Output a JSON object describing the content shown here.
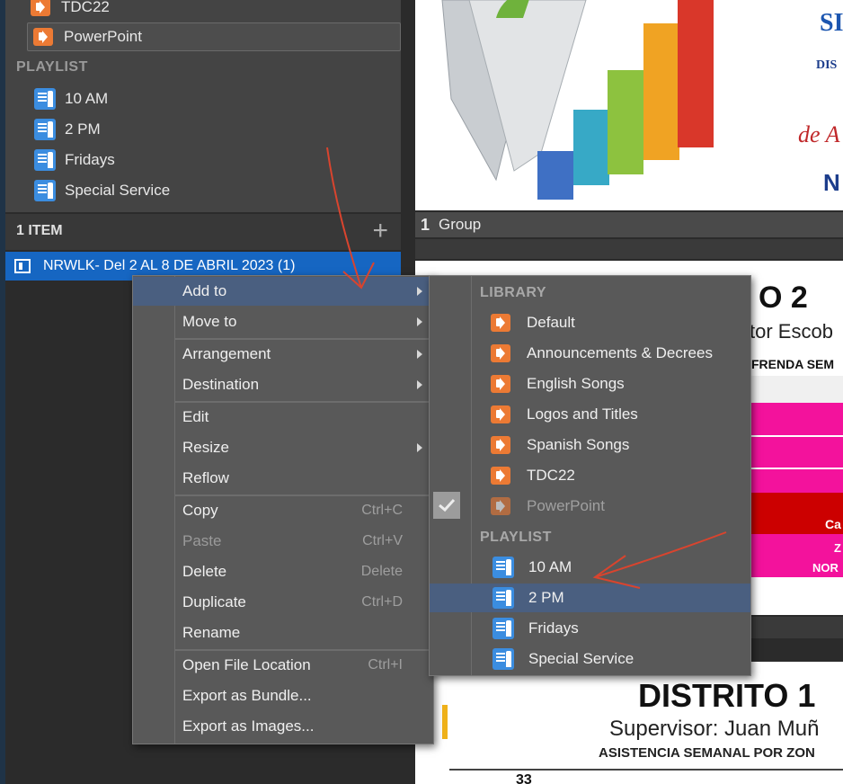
{
  "sidebar": {
    "library_items": [
      {
        "label": "TDC22",
        "icon": "presentation-icon"
      },
      {
        "label": "PowerPoint",
        "icon": "presentation-icon",
        "selected": true
      }
    ],
    "playlist_label": "PLAYLIST",
    "playlists": [
      {
        "label": "10 AM",
        "icon": "playlist-icon"
      },
      {
        "label": "2 PM",
        "icon": "playlist-icon"
      },
      {
        "label": "Fridays",
        "icon": "playlist-icon"
      },
      {
        "label": "Special Service",
        "icon": "playlist-icon"
      }
    ]
  },
  "items_panel": {
    "count_label": "1 ITEM",
    "add_label": "+",
    "selected_item": "NRWLK- Del 2 AL 8 DE ABRIL 2023 (1)"
  },
  "preview": {
    "group_number": "1",
    "group_label": "Group",
    "slide1_texts": [
      "SI",
      "DIS",
      "de A",
      "N"
    ],
    "slide2_title": "O 2",
    "slide2_subtitle": "tor Escob",
    "slide2_band": "FRENDA SEM",
    "slide2_cells": [
      "Ca",
      "Z",
      "NOR"
    ],
    "slide3_title": "DISTRITO 1",
    "slide3_subtitle": "Supervisor: Juan Muñ",
    "slide3_caption": "ASISTENCIA SEMANAL POR ZON",
    "slide3_number": "33"
  },
  "context_menu": {
    "items": [
      {
        "label": "Add to",
        "submenu": true,
        "highlighted": true
      },
      {
        "label": "Move to",
        "submenu": true
      },
      {
        "label": "Arrangement",
        "submenu": true
      },
      {
        "label": "Destination",
        "submenu": true
      },
      {
        "label": "Edit"
      },
      {
        "label": "Resize",
        "submenu": true
      },
      {
        "label": "Reflow"
      },
      {
        "label": "Copy",
        "shortcut": "Ctrl+C"
      },
      {
        "label": "Paste",
        "shortcut": "Ctrl+V",
        "disabled": true
      },
      {
        "label": "Delete",
        "shortcut": "Delete"
      },
      {
        "label": "Duplicate",
        "shortcut": "Ctrl+D"
      },
      {
        "label": "Rename"
      },
      {
        "label": "Open File Location",
        "shortcut": "Ctrl+I"
      },
      {
        "label": "Export as Bundle..."
      },
      {
        "label": "Export as Images..."
      }
    ]
  },
  "submenu": {
    "library_heading": "LIBRARY",
    "libraries": [
      {
        "label": "Default"
      },
      {
        "label": "Announcements & Decrees"
      },
      {
        "label": "English Songs"
      },
      {
        "label": "Logos and Titles"
      },
      {
        "label": "Spanish Songs"
      },
      {
        "label": "TDC22"
      },
      {
        "label": "PowerPoint",
        "checked": true,
        "disabled": true
      }
    ],
    "playlist_heading": "PLAYLIST",
    "playlists": [
      {
        "label": "10 AM"
      },
      {
        "label": "2 PM",
        "highlighted": true
      },
      {
        "label": "Fridays"
      },
      {
        "label": "Special Service"
      }
    ]
  },
  "colors": {
    "library_icon": "#ec7a34",
    "playlist_icon": "#3b8de0",
    "selection": "#1666c2",
    "menu_highlight": "#4a5f80",
    "annotation_arrow": "#d9442e"
  }
}
